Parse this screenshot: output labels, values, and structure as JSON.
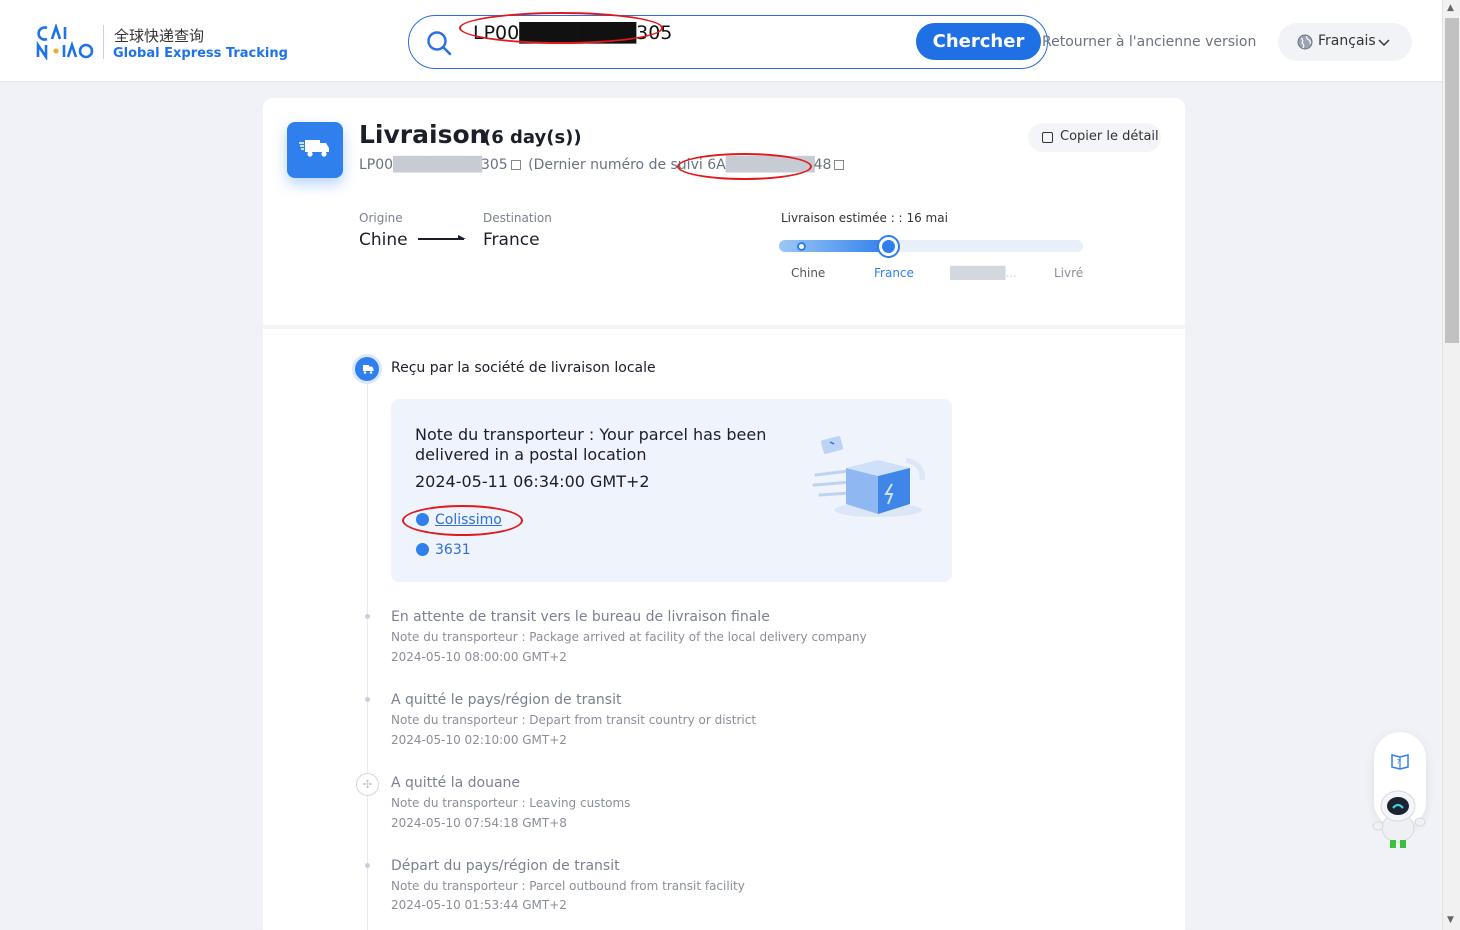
{
  "header": {
    "brand_cn": "全球快递查询",
    "brand_en": "Global Express Tracking",
    "search": {
      "value": "LP00████████305",
      "button": "Chercher"
    },
    "old_version": "Retourner à l'ancienne version",
    "language": "Français"
  },
  "summary": {
    "title": "Livraison",
    "days": "(6 day(s))",
    "tracking_prefix": "LP00",
    "tracking_blur": "█████████",
    "tracking_suffix": "305",
    "last_label": "(Dernier numéro de suivi",
    "last_prefix": "6A",
    "last_blur": "█████████",
    "last_suffix": "48",
    "copy_button": "Copier le détail",
    "origin_label": "Origine",
    "origin": "Chine",
    "destination_label": "Destination",
    "destination": "France",
    "eta_label": "Livraison estimée : :",
    "eta_date": "16 mai",
    "progress": 0.36,
    "stages": [
      "Chine",
      "France",
      "██████...",
      "Livré"
    ]
  },
  "latest": {
    "title": "Reçu par la société de livraison locale",
    "note": "Note du transporteur : Your parcel has been delivered in a postal location",
    "time": "2024-05-11 06:34:00 GMT+2",
    "carrier": "Colissimo",
    "phone": "3631"
  },
  "events": [
    {
      "title": "En attente de transit vers le bureau de livraison finale",
      "note": "Note du transporteur : Package arrived at facility of the local delivery company",
      "time": "2024-05-10 08:00:00 GMT+2"
    },
    {
      "title": "A quitté le pays/région de transit",
      "note": "Note du transporteur : Depart from transit country or district",
      "time": "2024-05-10 02:10:00 GMT+2"
    },
    {
      "title": "A quitté la douane",
      "note": "Note du transporteur : Leaving customs",
      "time": "2024-05-10 07:54:18 GMT+8"
    },
    {
      "title": "Départ du pays/région de transit",
      "note": "Note du transporteur : Parcel outbound from transit facility",
      "time": "2024-05-10 01:53:44 GMT+2"
    }
  ],
  "colors": {
    "primary": "#1f6fe5",
    "highlight": "#e0191d",
    "card_bg": "#eef3fc"
  }
}
